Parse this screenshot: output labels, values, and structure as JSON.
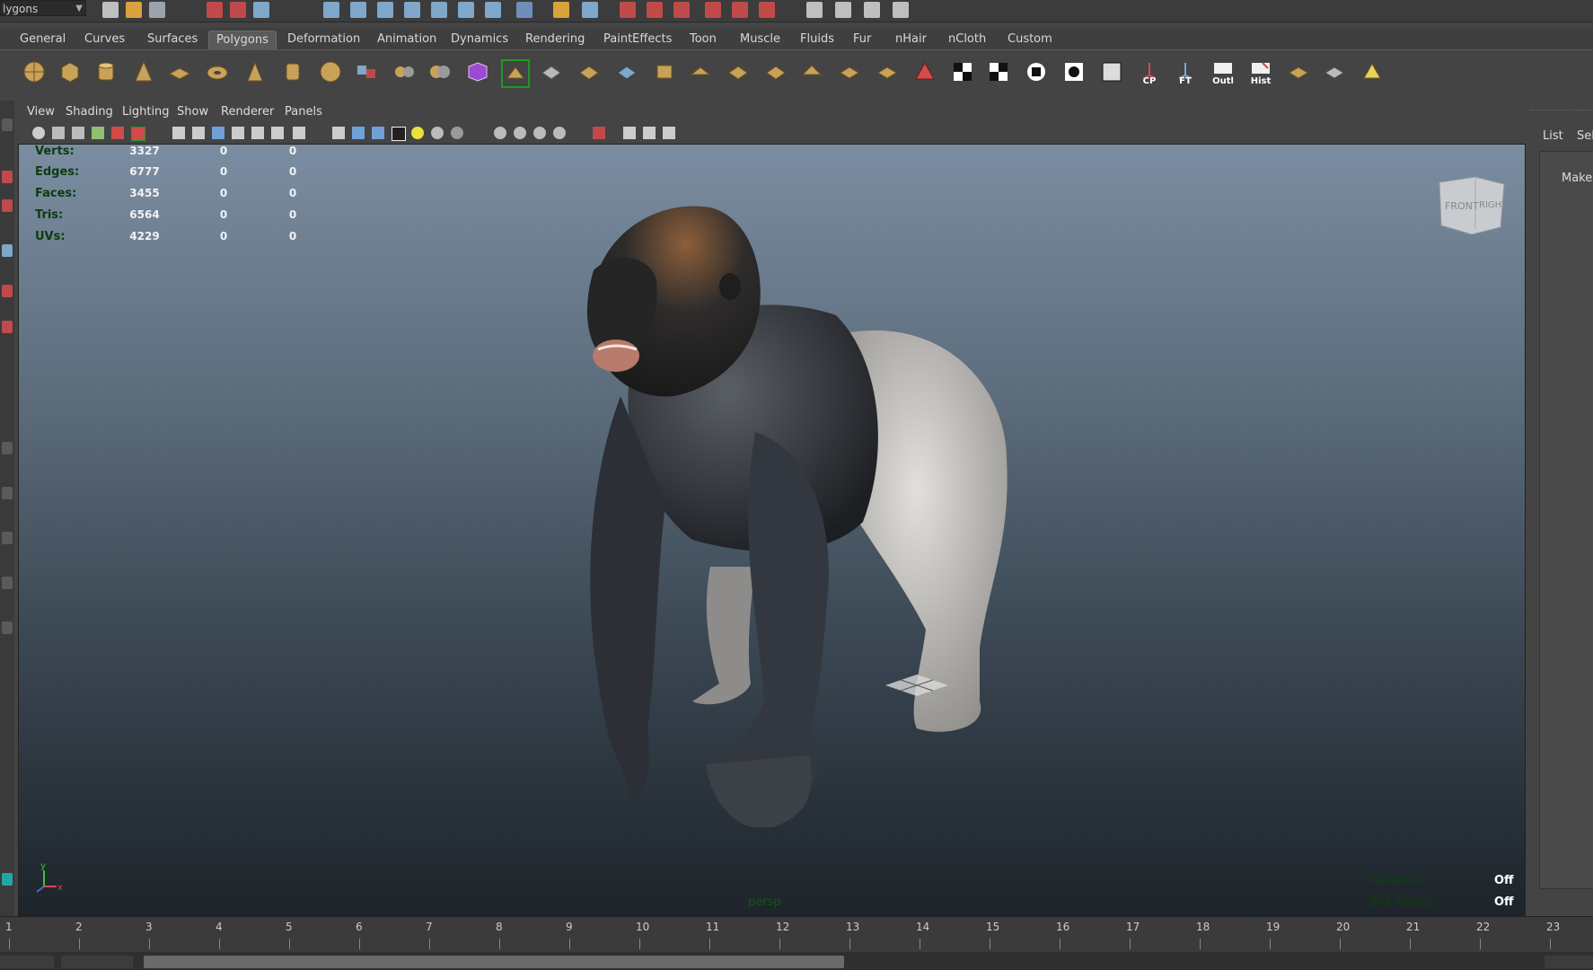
{
  "status_toolbar": {
    "mode_value": "lygons"
  },
  "shelf_tabs": [
    "General",
    "Curves",
    "Surfaces",
    "Polygons",
    "Deformation",
    "Animation",
    "Dynamics",
    "Rendering",
    "PaintEffects",
    "Toon",
    "Muscle",
    "Fluids",
    "Fur",
    "nHair",
    "nCloth",
    "Custom"
  ],
  "active_tab": "Polygons",
  "shelf_icon_labels": {
    "cp": "CP",
    "ft": "FT",
    "outl": "Outl",
    "hist": "Hist"
  },
  "panel_menus": [
    "View",
    "Shading",
    "Lighting",
    "Show",
    "Renderer",
    "Panels"
  ],
  "hud": {
    "rows": [
      {
        "label": "Verts:",
        "v1": "3327",
        "v2": "0",
        "v3": "0"
      },
      {
        "label": "Edges:",
        "v1": "6777",
        "v2": "0",
        "v3": "0"
      },
      {
        "label": "Faces:",
        "v1": "3455",
        "v2": "0",
        "v3": "0"
      },
      {
        "label": "Tris:",
        "v1": "6564",
        "v2": "0",
        "v3": "0"
      },
      {
        "label": "UVs:",
        "v1": "4229",
        "v2": "0",
        "v3": "0"
      }
    ],
    "viewcube_front": "FRONT",
    "viewcube_right": "RIGHT",
    "camera_name": "persp",
    "reflection_label": "Reflection:",
    "reflection_value": "Off",
    "soft_select_label": "Soft Select:",
    "soft_select_value": "Off",
    "axis_y": "y",
    "axis_x": "x"
  },
  "channel_box": {
    "tab_list": "List",
    "tab_sel": "Sel",
    "make_text": "Make a"
  },
  "timeline": {
    "frames": [
      "1",
      "2",
      "3",
      "4",
      "5",
      "6",
      "7",
      "8",
      "9",
      "10",
      "11",
      "12",
      "13",
      "14",
      "15",
      "16",
      "17",
      "18",
      "19",
      "20",
      "21",
      "22",
      "23"
    ]
  },
  "colors": {
    "hud_label": "#0d3b0d",
    "accent_active_tab": "#5a5a5a",
    "viewport_top": "#7b8da1",
    "viewport_bottom": "#1d242a"
  }
}
